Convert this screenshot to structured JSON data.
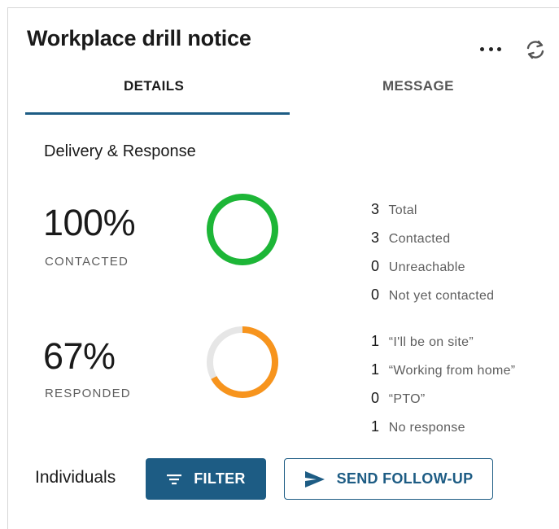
{
  "header": {
    "title": "Workplace drill notice",
    "more_icon": "more-horizontal-icon",
    "refresh_icon": "refresh-icon"
  },
  "tabs": [
    {
      "label": "DETAILS",
      "active": true
    },
    {
      "label": "MESSAGE",
      "active": false
    }
  ],
  "section": {
    "title": "Delivery & Response"
  },
  "contacted": {
    "percent": "100%",
    "label": "CONTACTED",
    "fraction": 1.0,
    "color": "#1db637",
    "stats": [
      {
        "num": "3",
        "label": "Total"
      },
      {
        "num": "3",
        "label": "Contacted"
      },
      {
        "num": "0",
        "label": "Unreachable"
      },
      {
        "num": "0",
        "label": "Not yet contacted"
      }
    ]
  },
  "responded": {
    "percent": "67%",
    "label": "RESPONDED",
    "fraction": 0.67,
    "color": "#f7941d",
    "track_color": "#e6e6e6",
    "stats": [
      {
        "num": "1",
        "label": "“I'll be on site”"
      },
      {
        "num": "1",
        "label": "“Working from home”"
      },
      {
        "num": "0",
        "label": "“PTO”"
      },
      {
        "num": "1",
        "label": "No response"
      }
    ]
  },
  "footer": {
    "individuals_label": "Individuals",
    "filter_label": "FILTER",
    "filter_icon": "filter-lines-icon",
    "followup_label": "SEND FOLLOW-UP",
    "followup_icon": "send-icon"
  },
  "colors": {
    "accent": "#1d5c84"
  }
}
